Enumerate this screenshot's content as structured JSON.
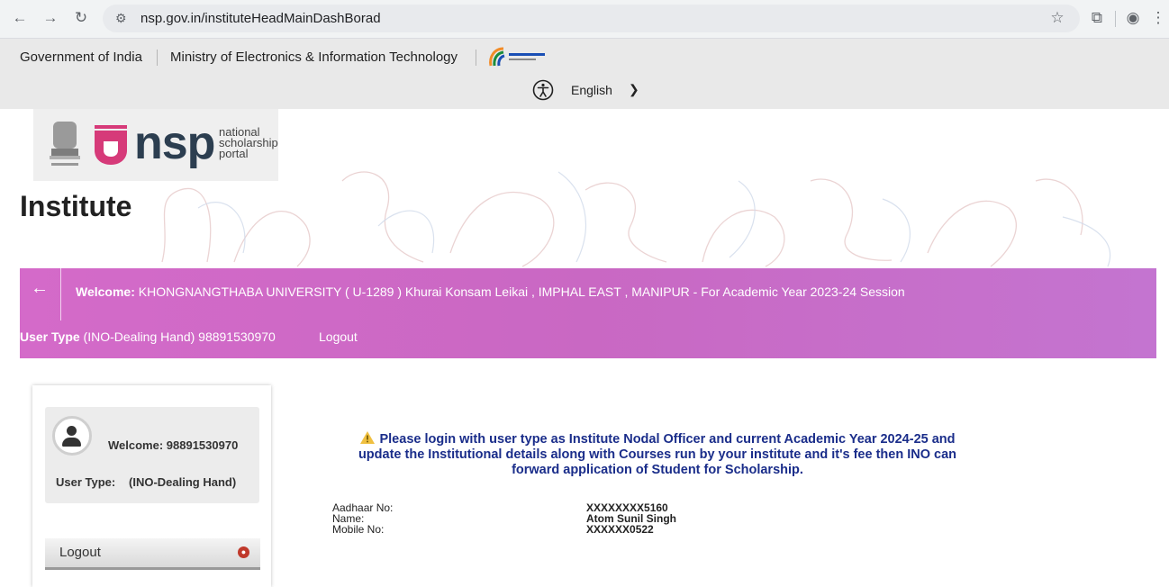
{
  "browser": {
    "url": "nsp.gov.in/instituteHeadMainDashBorad"
  },
  "gov_strip": {
    "government": "Government of India",
    "ministry": "Ministry of Electronics & Information Technology",
    "language": "English"
  },
  "header": {
    "brand": "nsp",
    "brand_sub": [
      "national",
      "scholarship",
      "portal"
    ],
    "page_title": "Institute"
  },
  "welcome_bar": {
    "welcome_label": "Welcome:",
    "welcome_text": " KHONGNANGTHABA UNIVERSITY ( U-1289 ) Khurai Konsam Leikai , IMPHAL EAST , MANIPUR - For Academic Year 2023-24 Session",
    "user_type_label": "User Type",
    "user_type_text": " (INO-Dealing Hand) 98891530970",
    "logout": "Logout"
  },
  "sidebar": {
    "welcome": "Welcome: 98891530970",
    "user_type_label": "User Type:",
    "user_type_value": "(INO-Dealing Hand)",
    "logout": "Logout"
  },
  "notice": {
    "line1": "Please login with user type as Institute Nodal Officer and current Academic Year 2024-25 and",
    "line2": "update the Institutional details along with Courses run by your institute and it's fee then INO can",
    "line3": "forward application of Student for Scholarship."
  },
  "details": {
    "aadhaar_label": "Aadhaar No:",
    "name_label": "Name:",
    "mobile_label": "Mobile No:",
    "aadhaar_value": "XXXXXXXX5160",
    "name_value": "Atom Sunil Singh",
    "mobile_value": "XXXXXX0522"
  },
  "colors": {
    "welcome_bar": "#cf6bc8",
    "notice_text": "#1a2d8a"
  }
}
